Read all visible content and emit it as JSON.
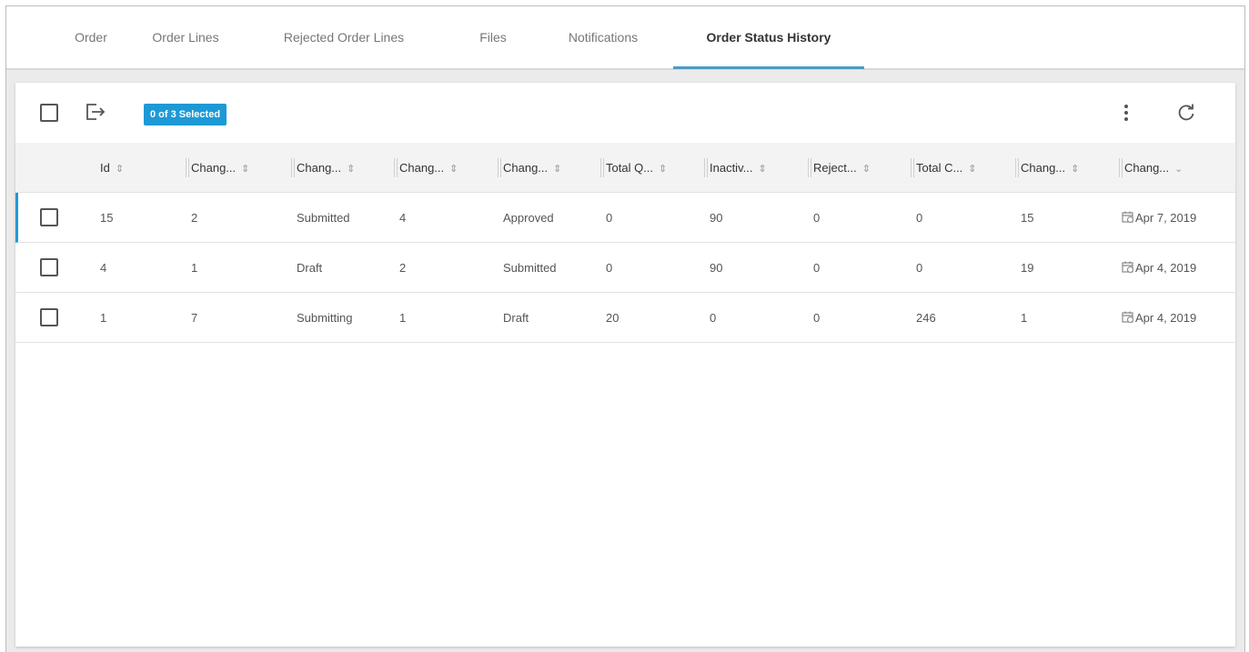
{
  "tabs": [
    {
      "label": "Order"
    },
    {
      "label": "Order Lines"
    },
    {
      "label": "Rejected Order Lines"
    },
    {
      "label": "Files"
    },
    {
      "label": "Notifications"
    },
    {
      "label": "Order Status History",
      "active": true
    }
  ],
  "toolbar": {
    "selection_badge": "0 of 3 Selected",
    "icons": [
      "checkbox",
      "export-icon",
      "more-vert-icon",
      "refresh-icon"
    ]
  },
  "table": {
    "columns": [
      "Id",
      "Chang...",
      "Chang...",
      "Chang...",
      "Chang...",
      "Total Q...",
      "Inactiv...",
      "Reject...",
      "Total C...",
      "Chang...",
      "Chang..."
    ],
    "column_sort_icons": [
      "sort",
      "sort",
      "sort",
      "sort",
      "sort",
      "sort",
      "sort",
      "sort",
      "sort",
      "sort",
      "chevron-down"
    ],
    "rows": [
      [
        "15",
        "2",
        "Submitted",
        "4",
        "Approved",
        "0",
        "90",
        "0",
        "0",
        "15",
        "Apr 7, 2019"
      ],
      [
        "4",
        "1",
        "Draft",
        "2",
        "Submitted",
        "0",
        "90",
        "0",
        "0",
        "19",
        "Apr 4, 2019"
      ],
      [
        "1",
        "7",
        "Submitting",
        "1",
        "Draft",
        "20",
        "0",
        "0",
        "246",
        "1",
        "Apr 4, 2019"
      ]
    ]
  },
  "colors": {
    "accent": "#1d9ad6",
    "tab_underline": "#4b9bc4"
  }
}
